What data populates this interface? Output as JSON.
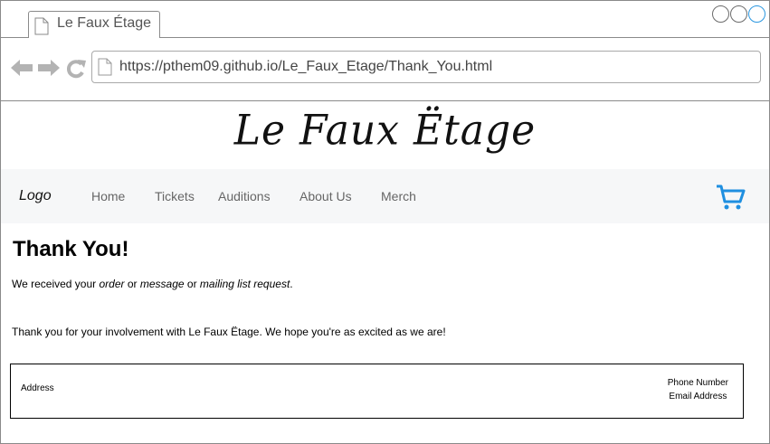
{
  "browser": {
    "tab_title": "Le Faux Étage",
    "url": "https://pthem09.github.io/Le_Faux_Etage/Thank_You.html"
  },
  "icons": {
    "back": "back-arrow-icon",
    "forward": "forward-arrow-icon",
    "reload": "reload-icon",
    "page": "page-icon",
    "cart": "cart-icon"
  },
  "colors": {
    "accent": "#2a97e0",
    "cart": "#1f8fe0",
    "navbar_bg": "#f6f7f8",
    "nav_icon_gray": "#b3b3b3"
  },
  "site": {
    "brand": "Le Faux Ëtage",
    "nav": {
      "logo": "Logo",
      "items": [
        "Home",
        "Tickets",
        "Auditions",
        "About Us",
        "Merch"
      ]
    }
  },
  "content": {
    "heading": "Thank You!",
    "received_prefix": "We received your ",
    "order": "order",
    "or1": " or ",
    "message": "message",
    "or2": " or ",
    "mailing": "mailing list request",
    "period": ".",
    "thanks": "Thank you for your involvement with Le Faux Ëtage. We hope you're as excited as we are!"
  },
  "footer": {
    "address": "Address",
    "phone": "Phone Number",
    "email": "Email Address"
  }
}
